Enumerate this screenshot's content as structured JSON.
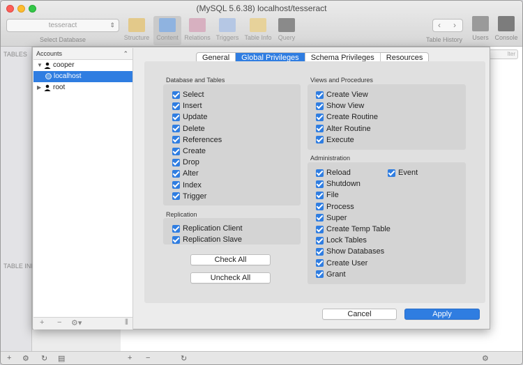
{
  "window": {
    "title": "(MySQL 5.6.38) localhost/tesseract"
  },
  "toolbar": {
    "database_select_value": "tesseract",
    "database_select_caption": "Select Database",
    "buttons": [
      {
        "label": "Structure"
      },
      {
        "label": "Content"
      },
      {
        "label": "Relations"
      },
      {
        "label": "Triggers"
      },
      {
        "label": "Table Info"
      },
      {
        "label": "Query"
      }
    ],
    "history_caption": "Table History",
    "users_label": "Users",
    "console_label": "Console"
  },
  "sidebar": {
    "tables_label": "TABLES",
    "table_info_label": "TABLE INF"
  },
  "filter_placeholder": "lter",
  "accounts": {
    "header": "Accounts",
    "items": [
      {
        "label": "cooper"
      },
      {
        "label": "localhost"
      },
      {
        "label": "root"
      }
    ]
  },
  "tabs": [
    {
      "label": "General"
    },
    {
      "label": "Global Privileges"
    },
    {
      "label": "Schema Privileges"
    },
    {
      "label": "Resources"
    }
  ],
  "groups": {
    "db_tables": {
      "title": "Database and Tables",
      "items": [
        "Select",
        "Insert",
        "Update",
        "Delete",
        "References",
        "Create",
        "Drop",
        "Alter",
        "Index",
        "Trigger"
      ]
    },
    "replication": {
      "title": "Replication",
      "items": [
        "Replication Client",
        "Replication Slave"
      ]
    },
    "views": {
      "title": "Views and Procedures",
      "items": [
        "Create View",
        "Show View",
        "Create Routine",
        "Alter Routine",
        "Execute"
      ]
    },
    "admin": {
      "title": "Administration",
      "items": [
        "Reload",
        "Event",
        "Shutdown",
        "File",
        "Process",
        "Super",
        "Create Temp Table",
        "Lock Tables",
        "Show Databases",
        "Create User",
        "Grant"
      ]
    }
  },
  "buttons": {
    "check_all": "Check All",
    "uncheck_all": "Uncheck All",
    "cancel": "Cancel",
    "apply": "Apply"
  },
  "colors": {
    "accent": "#2f7de1"
  }
}
